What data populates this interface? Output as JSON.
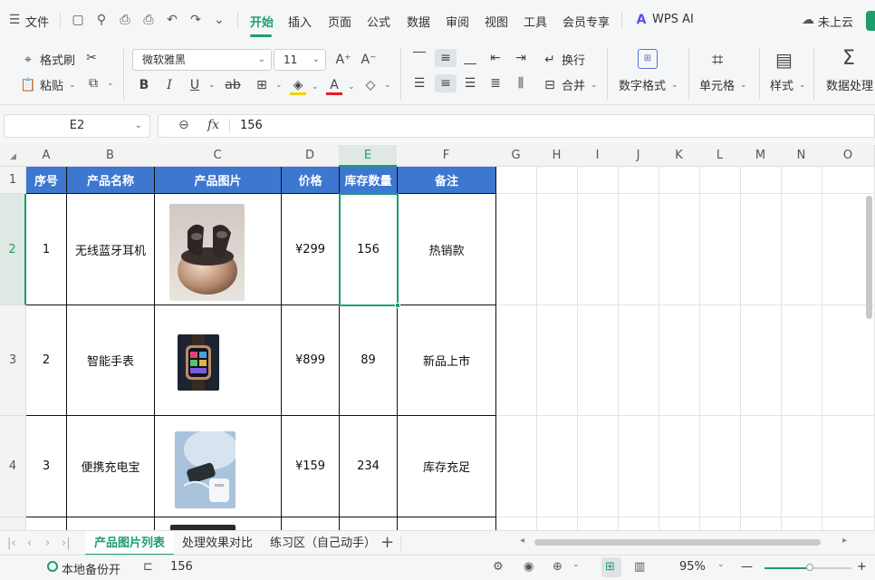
{
  "menubar": {
    "file_label": "文件",
    "tabs": [
      "开始",
      "插入",
      "页面",
      "公式",
      "数据",
      "审阅",
      "视图",
      "工具",
      "会员专享"
    ],
    "ai_label": "WPS AI",
    "cloud_label": "未上云"
  },
  "ribbon": {
    "format_painter": "格式刷",
    "paste": "粘贴",
    "font_name": "微软雅黑",
    "font_size": "11",
    "wrap": "换行",
    "merge": "合并",
    "number_format": "数字格式",
    "cell": "单元格",
    "style": "样式",
    "data_process": "数据处理"
  },
  "formula_bar": {
    "name_box": "E2",
    "fx": "fx",
    "value": "156"
  },
  "grid": {
    "columns": [
      "A",
      "B",
      "C",
      "D",
      "E",
      "F",
      "G",
      "H",
      "I",
      "J",
      "K",
      "L",
      "M",
      "N",
      "O"
    ],
    "rows": [
      "1",
      "2",
      "3",
      "4"
    ],
    "header": [
      "序号",
      "产品名称",
      "产品图片",
      "价格",
      "库存数量",
      "备注"
    ],
    "data": [
      {
        "no": "1",
        "name": "无线蓝牙耳机",
        "price": "¥299",
        "stock": "156",
        "note": "热销款",
        "img": "earbuds-image"
      },
      {
        "no": "2",
        "name": "智能手表",
        "price": "¥899",
        "stock": "89",
        "note": "新品上市",
        "img": "smartwatch-image"
      },
      {
        "no": "3",
        "name": "便携充电宝",
        "price": "¥159",
        "stock": "234",
        "note": "库存充足",
        "img": "powerbank-image"
      }
    ]
  },
  "sheets": [
    "产品图片列表",
    "处理效果对比",
    "练习区（自己动手）"
  ],
  "status": {
    "backup": "本地备份开",
    "cell_value": "156",
    "zoom": "95%"
  },
  "colors": {
    "accent": "#1f9d6b",
    "header_fill": "#3d77d0"
  }
}
